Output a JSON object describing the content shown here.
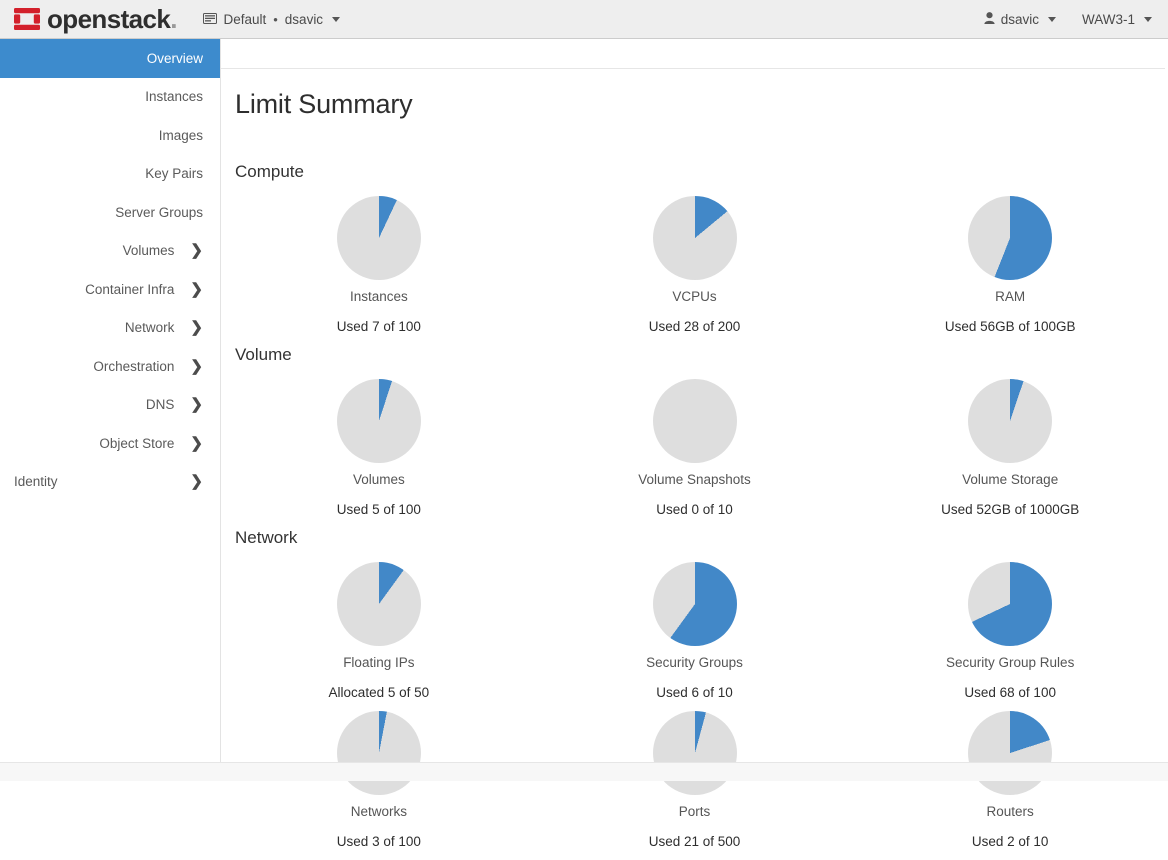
{
  "navbar": {
    "brand_name": "openstack",
    "brand_dot": ".",
    "logo_icon": "openstack-logo-icon",
    "context": {
      "domain_icon": "domain-icon",
      "domain_label": "Default",
      "separator": "•",
      "project_label": "dsavic",
      "caret_icon": "chevron-down-icon"
    },
    "user_menu": {
      "icon": "user-icon",
      "label": "dsavic",
      "caret_icon": "chevron-down-icon"
    },
    "region_menu": {
      "label": "WAW3-1",
      "caret_icon": "chevron-down-icon"
    }
  },
  "sidebar": {
    "items": [
      {
        "label": "Overview",
        "active": true,
        "expandable": false,
        "icon": ""
      },
      {
        "label": "Instances",
        "active": false,
        "expandable": false,
        "icon": ""
      },
      {
        "label": "Images",
        "active": false,
        "expandable": false,
        "icon": ""
      },
      {
        "label": "Key Pairs",
        "active": false,
        "expandable": false,
        "icon": ""
      },
      {
        "label": "Server Groups",
        "active": false,
        "expandable": false,
        "icon": ""
      },
      {
        "label": "Volumes",
        "active": false,
        "expandable": true,
        "icon": "chevron-right-icon"
      },
      {
        "label": "Container Infra",
        "active": false,
        "expandable": true,
        "icon": "chevron-right-icon"
      },
      {
        "label": "Network",
        "active": false,
        "expandable": true,
        "icon": "chevron-right-icon"
      },
      {
        "label": "Orchestration",
        "active": false,
        "expandable": true,
        "icon": "chevron-right-icon"
      },
      {
        "label": "DNS",
        "active": false,
        "expandable": true,
        "icon": "chevron-right-icon"
      },
      {
        "label": "Object Store",
        "active": false,
        "expandable": true,
        "icon": "chevron-right-icon"
      },
      {
        "label": "Identity",
        "active": false,
        "expandable": true,
        "icon": "chevron-right-icon"
      }
    ]
  },
  "main": {
    "page_title": "Limit Summary",
    "sections": [
      {
        "heading": "Compute"
      },
      {
        "heading": "Volume"
      },
      {
        "heading": "Network"
      }
    ]
  },
  "colors": {
    "used": "#4288c8",
    "free": "#dedede",
    "accent": "#3d8bcd",
    "brand_red": "#d3202b",
    "navbar_bg": "#eeeeee"
  },
  "chart_data": [
    {
      "type": "pie",
      "title": "Instances",
      "section": "Compute",
      "value_label": "Used 7 of 100",
      "used": 7,
      "total": 100,
      "percent": 7,
      "slices": [
        {
          "name": "Used",
          "value": 7,
          "color": "#4288c8"
        },
        {
          "name": "Available",
          "value": 93,
          "color": "#dedede"
        }
      ]
    },
    {
      "type": "pie",
      "title": "VCPUs",
      "section": "Compute",
      "value_label": "Used 28 of 200",
      "used": 28,
      "total": 200,
      "percent": 14,
      "slices": [
        {
          "name": "Used",
          "value": 28,
          "color": "#4288c8"
        },
        {
          "name": "Available",
          "value": 172,
          "color": "#dedede"
        }
      ]
    },
    {
      "type": "pie",
      "title": "RAM",
      "section": "Compute",
      "value_label": "Used 56GB of 100GB",
      "used": 56,
      "total": 100,
      "percent": 56,
      "slices": [
        {
          "name": "Used",
          "value": 56,
          "color": "#4288c8"
        },
        {
          "name": "Available",
          "value": 44,
          "color": "#dedede"
        }
      ]
    },
    {
      "type": "pie",
      "title": "Volumes",
      "section": "Volume",
      "value_label": "Used 5 of 100",
      "used": 5,
      "total": 100,
      "percent": 5,
      "slices": [
        {
          "name": "Used",
          "value": 5,
          "color": "#4288c8"
        },
        {
          "name": "Available",
          "value": 95,
          "color": "#dedede"
        }
      ]
    },
    {
      "type": "pie",
      "title": "Volume Snapshots",
      "section": "Volume",
      "value_label": "Used 0 of 10",
      "used": 0,
      "total": 10,
      "percent": 0,
      "slices": [
        {
          "name": "Used",
          "value": 0,
          "color": "#4288c8"
        },
        {
          "name": "Available",
          "value": 10,
          "color": "#dedede"
        }
      ]
    },
    {
      "type": "pie",
      "title": "Volume Storage",
      "section": "Volume",
      "value_label": "Used 52GB of 1000GB",
      "used": 52,
      "total": 1000,
      "percent": 5.2,
      "slices": [
        {
          "name": "Used",
          "value": 52,
          "color": "#4288c8"
        },
        {
          "name": "Available",
          "value": 948,
          "color": "#dedede"
        }
      ]
    },
    {
      "type": "pie",
      "title": "Floating IPs",
      "section": "Network",
      "value_label": "Allocated 5 of 50",
      "used": 5,
      "total": 50,
      "percent": 10,
      "slices": [
        {
          "name": "Allocated",
          "value": 5,
          "color": "#4288c8"
        },
        {
          "name": "Available",
          "value": 45,
          "color": "#dedede"
        }
      ]
    },
    {
      "type": "pie",
      "title": "Security Groups",
      "section": "Network",
      "value_label": "Used 6 of 10",
      "used": 6,
      "total": 10,
      "percent": 60,
      "slices": [
        {
          "name": "Used",
          "value": 6,
          "color": "#4288c8"
        },
        {
          "name": "Available",
          "value": 4,
          "color": "#dedede"
        }
      ]
    },
    {
      "type": "pie",
      "title": "Security Group Rules",
      "section": "Network",
      "value_label": "Used 68 of 100",
      "used": 68,
      "total": 100,
      "percent": 68,
      "slices": [
        {
          "name": "Used",
          "value": 68,
          "color": "#4288c8"
        },
        {
          "name": "Available",
          "value": 32,
          "color": "#dedede"
        }
      ]
    },
    {
      "type": "pie",
      "title": "Networks",
      "section": "Network",
      "value_label": "Used 3 of 100",
      "used": 3,
      "total": 100,
      "percent": 3,
      "slices": [
        {
          "name": "Used",
          "value": 3,
          "color": "#4288c8"
        },
        {
          "name": "Available",
          "value": 97,
          "color": "#dedede"
        }
      ]
    },
    {
      "type": "pie",
      "title": "Ports",
      "section": "Network",
      "value_label": "Used 21 of 500",
      "used": 21,
      "total": 500,
      "percent": 4.2,
      "slices": [
        {
          "name": "Used",
          "value": 21,
          "color": "#4288c8"
        },
        {
          "name": "Available",
          "value": 479,
          "color": "#dedede"
        }
      ]
    },
    {
      "type": "pie",
      "title": "Routers",
      "section": "Network",
      "value_label": "Used 2 of 10",
      "used": 2,
      "total": 10,
      "percent": 20,
      "slices": [
        {
          "name": "Used",
          "value": 2,
          "color": "#4288c8"
        },
        {
          "name": "Available",
          "value": 8,
          "color": "#dedede"
        }
      ]
    }
  ]
}
